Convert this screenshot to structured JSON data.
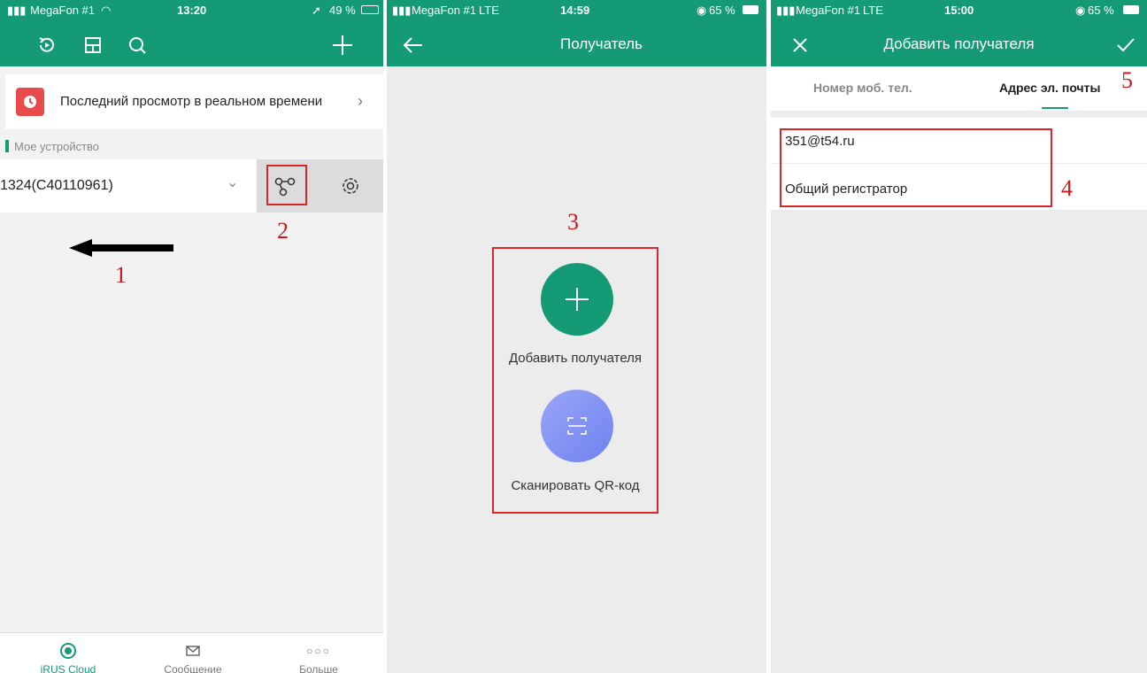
{
  "panel1": {
    "status": {
      "carrier": "MegaFon #1",
      "time": "13:20",
      "battery": "49 %"
    },
    "live_view_label": "Последний просмотр в реальном времени",
    "section_label": "Мое устройство",
    "device_name": "1324(C40110961)",
    "tabs": [
      {
        "label": "iRUS Cloud",
        "icon": "cloud-icon",
        "active": true
      },
      {
        "label": "Сообщение",
        "icon": "message-icon",
        "active": false
      },
      {
        "label": "Больше",
        "icon": "more-icon",
        "active": false
      }
    ],
    "step_labels": {
      "arrow_step": "1",
      "share_step": "2"
    }
  },
  "panel2": {
    "status": {
      "carrier": "MegaFon #1",
      "network": "LTE",
      "time": "14:59",
      "battery": "65 %"
    },
    "title": "Получатель",
    "add_label": "Добавить получателя",
    "scan_label": "Сканировать QR-код",
    "step_label": "3"
  },
  "panel3": {
    "status": {
      "carrier": "MegaFon #1",
      "network": "LTE",
      "time": "15:00",
      "battery": "65 %"
    },
    "title": "Добавить получателя",
    "tab_phone": "Номер моб. тел.",
    "tab_email": "Адрес эл. почты",
    "email_value": "351@t54.ru",
    "name_value": "Общий регистратор",
    "step_labels": {
      "fields_step": "4",
      "confirm_step": "5"
    }
  },
  "colors": {
    "accent": "#149a74",
    "annotation_red": "#d9262c",
    "scan_gradient": "#7b8cf5"
  }
}
